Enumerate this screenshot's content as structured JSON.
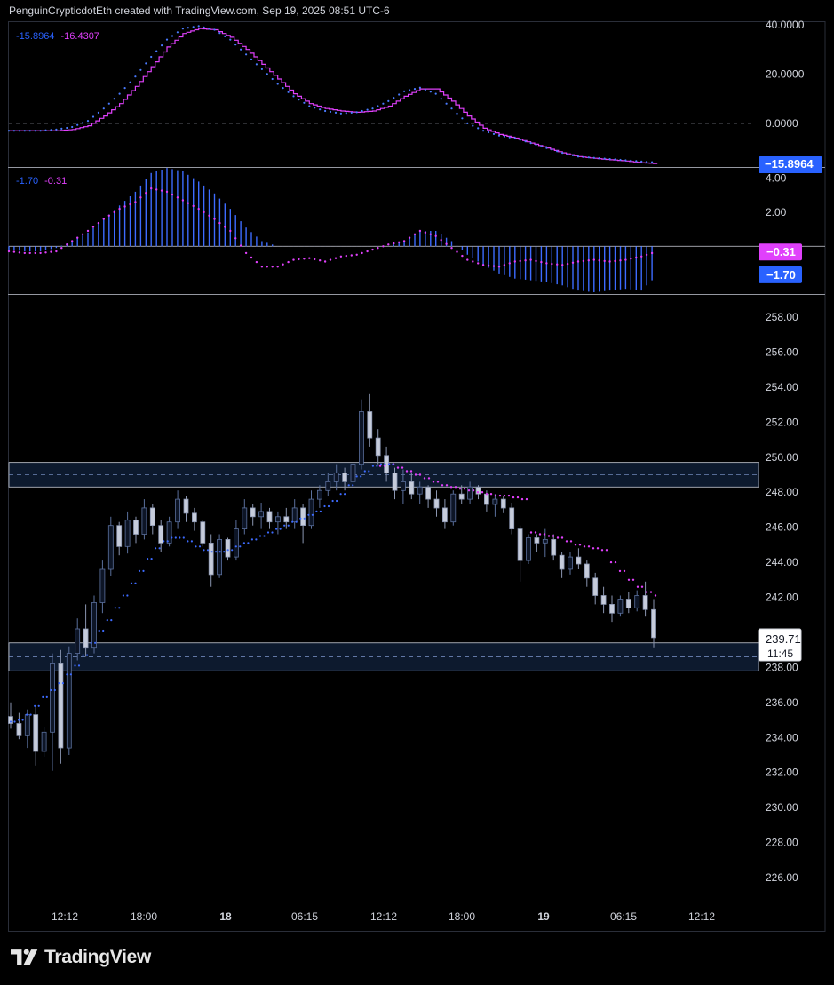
{
  "header": {
    "title": "PenguinCrypticdotEth created with TradingView.com, Sep 19, 2025 08:51 UTC-6"
  },
  "logo": {
    "text": "TradingView"
  },
  "colors": {
    "blue": "#2962ff",
    "magenta": "#e040fb",
    "up": "#4a5f8a",
    "down": "#7f8aa6",
    "zone": "#0d1a2e"
  },
  "time_axis": {
    "labels": [
      "12:12",
      "18:00",
      "18",
      "06:15",
      "12:12",
      "18:00",
      "19",
      "06:15",
      "12:12"
    ],
    "bold": [
      "18",
      "19"
    ]
  },
  "pane1": {
    "legend": [
      "-15.8964",
      "-16.4307"
    ],
    "ticks": [
      "40.0000",
      "20.0000",
      "0.0000"
    ],
    "last_label": "−15.8964"
  },
  "pane2": {
    "legend": [
      "-1.70",
      "-0.31"
    ],
    "ticks": [
      "4.00",
      "2.00"
    ],
    "last_labels": [
      "−0.31",
      "−1.70"
    ]
  },
  "price": {
    "ticks": [
      "258.00",
      "256.00",
      "254.00",
      "252.00",
      "250.00",
      "248.00",
      "246.00",
      "244.00",
      "242.00",
      "238.00",
      "236.00",
      "234.00",
      "232.00",
      "230.00",
      "228.00",
      "226.00"
    ],
    "last_price": "239.71",
    "countdown": "11:45"
  },
  "chart_data": [
    {
      "type": "line",
      "name": "oscillator pane",
      "ylim": [
        -17,
        40
      ],
      "zero_line": 0,
      "series": [
        {
          "name": "-15.8964",
          "color": "#2962ff",
          "style": "dots",
          "values": [
            -3,
            -3,
            -3,
            -2.5,
            -1.5,
            1,
            6,
            12,
            19,
            27,
            34,
            38.5,
            39.5,
            38,
            34,
            28,
            22,
            16,
            11,
            7,
            5,
            4,
            4.5,
            6,
            9,
            13,
            14.5,
            12,
            6,
            0,
            -3,
            -5,
            -6,
            -8,
            -10,
            -12,
            -13.5,
            -14,
            -14.5,
            -15,
            -15.5,
            -15.9
          ]
        },
        {
          "name": "-16.4307",
          "color": "#e040fb",
          "style": "step",
          "values": [
            -3,
            -3,
            -3,
            -3,
            -2.5,
            -1,
            3,
            8,
            15,
            23,
            31,
            36.5,
            38.5,
            38,
            35,
            30,
            24,
            18,
            12,
            8,
            6,
            5,
            4.5,
            5,
            7,
            11,
            14,
            14,
            9,
            3,
            -2,
            -4.5,
            -6,
            -8,
            -10,
            -12,
            -13.5,
            -14.2,
            -14.8,
            -15.3,
            -16,
            -16.4
          ]
        }
      ]
    },
    {
      "type": "bar",
      "name": "histogram pane",
      "ylim": [
        -2.7,
        4.5
      ],
      "zero_line": 0,
      "series": [
        {
          "name": "-1.70",
          "color": "#2962ff",
          "style": "histogram",
          "values": [
            -0.2,
            -0.3,
            -0.3,
            -0.1,
            0.3,
            0.8,
            1.6,
            2.4,
            3.2,
            4.3,
            4.6,
            4.4,
            3.8,
            3.1,
            2.2,
            1.1,
            0.3,
            0,
            0,
            0,
            0,
            0,
            0,
            0,
            0,
            0.3,
            0.9,
            0.9,
            0.3,
            -0.5,
            -1.1,
            -1.6,
            -1.9,
            -2.0,
            -2.1,
            -2.3,
            -2.6,
            -2.7,
            -2.6,
            -2.5,
            -2.6,
            -1.7
          ]
        },
        {
          "name": "-0.31",
          "color": "#e040fb",
          "style": "dots",
          "values": [
            -0.3,
            -0.4,
            -0.4,
            -0.3,
            0.3,
            0.9,
            1.6,
            2.2,
            2.6,
            3.4,
            3.2,
            2.7,
            2.2,
            1.6,
            0.9,
            -0.4,
            -1.2,
            -1.2,
            -0.8,
            -0.7,
            -0.9,
            -0.6,
            -0.5,
            -0.2,
            0.1,
            0.3,
            0.9,
            0.6,
            -0.1,
            -0.8,
            -1.1,
            -1.2,
            -0.9,
            -0.8,
            -1.0,
            -1.1,
            -0.9,
            -0.8,
            -0.9,
            -0.8,
            -0.6,
            -0.31
          ]
        }
      ]
    },
    {
      "type": "candlestick",
      "name": "price pane",
      "ylim": [
        224,
        260
      ],
      "zones": [
        [
          248.3,
          249.7
        ],
        [
          237.8,
          239.4
        ]
      ],
      "zone_midlines": [
        249.0,
        238.6
      ],
      "candles": [
        [
          235.2,
          236,
          234.5,
          234.8
        ],
        [
          234.8,
          235.4,
          233.9,
          234.1
        ],
        [
          234.1,
          235.6,
          233.4,
          235.3
        ],
        [
          235.3,
          235.8,
          232.4,
          233.2
        ],
        [
          233.2,
          234.6,
          232.9,
          234.3
        ],
        [
          234.3,
          238.8,
          232.1,
          238.2
        ],
        [
          238.2,
          239,
          232.5,
          233.4
        ],
        [
          233.4,
          239.2,
          233,
          238.8
        ],
        [
          238.8,
          240.8,
          238.4,
          240.2
        ],
        [
          240.2,
          241.6,
          238.6,
          239.1
        ],
        [
          239.1,
          242.1,
          238.8,
          241.7
        ],
        [
          241.7,
          244.1,
          241.1,
          243.6
        ],
        [
          243.6,
          246.6,
          243.2,
          246.1
        ],
        [
          246.1,
          246.3,
          244.4,
          244.9
        ],
        [
          244.9,
          246.9,
          244.5,
          246.4
        ],
        [
          246.4,
          246.6,
          245.1,
          245.6
        ],
        [
          245.6,
          247.6,
          245.3,
          247.1
        ],
        [
          247.1,
          247.3,
          245.6,
          246.1
        ],
        [
          246.1,
          246.4,
          244.6,
          245.1
        ],
        [
          245.1,
          246.6,
          244.9,
          246.3
        ],
        [
          246.3,
          248.1,
          245.9,
          247.6
        ],
        [
          247.6,
          247.8,
          246.3,
          246.8
        ],
        [
          246.8,
          247.1,
          245.8,
          246.3
        ],
        [
          246.3,
          246.4,
          244.9,
          245.1
        ],
        [
          245.1,
          245.6,
          242.6,
          243.3
        ],
        [
          243.3,
          245.6,
          243.1,
          245.3
        ],
        [
          245.3,
          245.4,
          244.1,
          244.3
        ],
        [
          244.3,
          246.4,
          244.1,
          245.9
        ],
        [
          245.9,
          247.6,
          245.6,
          247.1
        ],
        [
          247.1,
          247.3,
          246.1,
          246.6
        ],
        [
          246.6,
          247.4,
          245.9,
          246.9
        ],
        [
          246.9,
          247.1,
          245.9,
          246.3
        ],
        [
          246.3,
          246.9,
          245.6,
          246.6
        ],
        [
          246.6,
          247.1,
          245.9,
          246.3
        ],
        [
          246.3,
          247.6,
          245.9,
          247.1
        ],
        [
          247.1,
          247.3,
          245.1,
          246.1
        ],
        [
          246.1,
          248.1,
          245.9,
          247.6
        ],
        [
          247.6,
          248.4,
          247.1,
          248.1
        ],
        [
          248.1,
          249.1,
          247.8,
          248.6
        ],
        [
          248.6,
          249.6,
          248.1,
          249.1
        ],
        [
          249.1,
          249.4,
          248.1,
          248.6
        ],
        [
          248.6,
          250.1,
          248.3,
          249.6
        ],
        [
          249.6,
          253.3,
          249.3,
          252.6
        ],
        [
          252.6,
          253.6,
          250.6,
          251.1
        ],
        [
          251.1,
          251.6,
          249.6,
          250.1
        ],
        [
          250.1,
          250.6,
          248.6,
          249.1
        ],
        [
          249.1,
          249.4,
          247.6,
          248.1
        ],
        [
          248.1,
          249.3,
          247.3,
          248.6
        ],
        [
          248.6,
          249.1,
          247.6,
          247.9
        ],
        [
          247.9,
          248.6,
          247.3,
          248.3
        ],
        [
          248.3,
          248.4,
          247.1,
          247.6
        ],
        [
          247.6,
          248.1,
          246.6,
          247.1
        ],
        [
          247.1,
          247.6,
          245.9,
          246.3
        ],
        [
          246.3,
          248.1,
          246.1,
          247.9
        ],
        [
          247.9,
          248.4,
          247.3,
          247.6
        ],
        [
          247.6,
          248.6,
          247.3,
          248.3
        ],
        [
          248.3,
          248.4,
          247.6,
          247.9
        ],
        [
          247.9,
          248.1,
          246.9,
          247.3
        ],
        [
          247.3,
          247.9,
          246.6,
          247.6
        ],
        [
          247.6,
          247.8,
          246.8,
          247.1
        ],
        [
          247.1,
          247.4,
          245.6,
          245.9
        ],
        [
          245.9,
          246.1,
          242.9,
          244.1
        ],
        [
          244.1,
          245.6,
          243.9,
          245.4
        ],
        [
          245.4,
          245.6,
          244.6,
          245.1
        ],
        [
          245.1,
          245.9,
          244.3,
          245.3
        ],
        [
          245.3,
          245.6,
          244.1,
          244.4
        ],
        [
          244.4,
          244.6,
          243.1,
          243.6
        ],
        [
          243.6,
          244.6,
          243.3,
          244.3
        ],
        [
          244.3,
          244.8,
          243.6,
          243.9
        ],
        [
          243.9,
          244.1,
          242.6,
          243.1
        ],
        [
          243.1,
          243.4,
          241.6,
          242.1
        ],
        [
          242.1,
          242.6,
          241.1,
          241.6
        ],
        [
          241.6,
          242.1,
          240.6,
          241.1
        ],
        [
          241.1,
          242.1,
          240.9,
          241.9
        ],
        [
          241.9,
          242.3,
          241.1,
          241.4
        ],
        [
          241.4,
          242.4,
          241.2,
          242.1
        ],
        [
          242.1,
          242.9,
          240.9,
          241.3
        ],
        [
          241.3,
          241.9,
          239.1,
          239.7
        ]
      ],
      "series": [
        {
          "name": "upper trailing dots",
          "color": "#e040fb",
          "style": "dots",
          "values": [
            249.5,
            249.6,
            249.4,
            249.2,
            249,
            248.8,
            248.6,
            248.4,
            248.3,
            248.2,
            248.1,
            248.0,
            247.9,
            247.8,
            247.8,
            247.7,
            247.6,
            245.7,
            245.6,
            245.5,
            245.4,
            245.2,
            245.0,
            244.9,
            244.8,
            244.7,
            244.0,
            243.5,
            243.0,
            242.6,
            242.3,
            242.1
          ]
        },
        {
          "name": "lower trailing dots",
          "color": "#2962ff",
          "style": "dots",
          "values": [
            234.9,
            235.0,
            235.3,
            235.8,
            236.3,
            236.7,
            237.1,
            237.6,
            238.1,
            238.7,
            239.4,
            240.1,
            240.7,
            241.4,
            242.1,
            242.8,
            243.5,
            244.2,
            244.8,
            245.2,
            245.4,
            245.4,
            245.2,
            244.9,
            244.7,
            244.6,
            244.6,
            244.7,
            244.9,
            245.1,
            245.3,
            245.5,
            245.7,
            245.9,
            246.1,
            246.3,
            246.5,
            246.7,
            246.9,
            247.2,
            247.5,
            247.9,
            248.4,
            248.9,
            249.2,
            249.5,
            249.6,
            249.6
          ]
        }
      ]
    }
  ]
}
